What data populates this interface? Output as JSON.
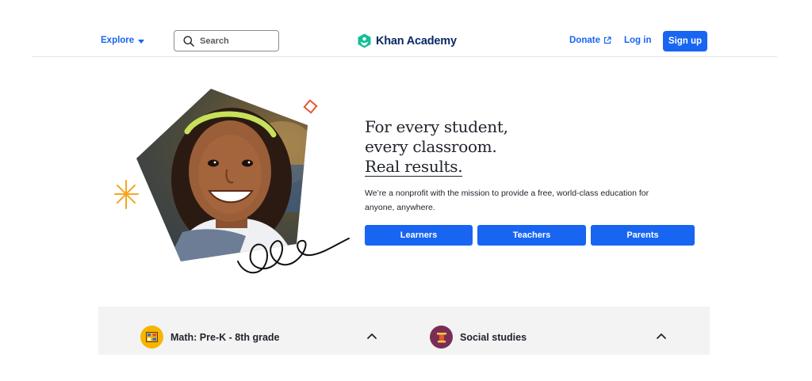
{
  "header": {
    "explore_label": "Explore",
    "search_placeholder": "Search",
    "logo_text": "Khan Academy",
    "donate_label": "Donate",
    "login_label": "Log in",
    "signup_label": "Sign up"
  },
  "hero": {
    "title_line1": "For every student,",
    "title_line2": "every classroom.",
    "title_line3": "Real results.",
    "description": "We’re a nonprofit with the mission to provide a free, world-class education for anyone, anywhere.",
    "buttons": [
      "Learners",
      "Teachers",
      "Parents"
    ]
  },
  "subjects": [
    {
      "label": "Math: Pre-K - 8th grade",
      "icon": "abacus-icon",
      "color": "#f7b500"
    },
    {
      "label": "Social studies",
      "icon": "column-icon",
      "color": "#7a2e55"
    }
  ],
  "colors": {
    "brand_blue": "#1865f2",
    "logo_green": "#14bf96",
    "text_dark": "#21242c",
    "strip_bg": "#f3f3f3"
  }
}
